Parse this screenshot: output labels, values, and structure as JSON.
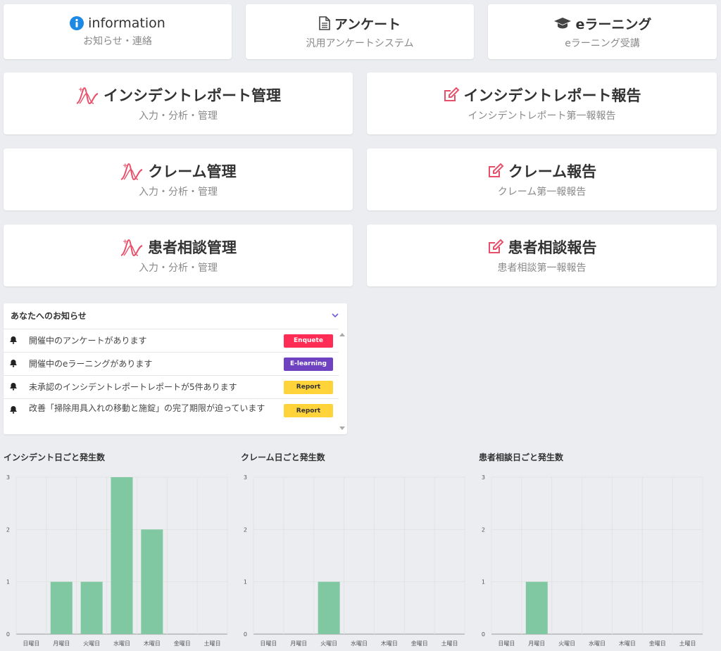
{
  "top_cards": [
    {
      "title": "information",
      "subtitle": "お知らせ・連絡"
    },
    {
      "title": "アンケート",
      "subtitle": "汎用アンケートシステム"
    },
    {
      "title": "eラーニング",
      "subtitle": "eラーニング受講"
    }
  ],
  "main_cards": {
    "incident_mgmt": {
      "title": "インシデントレポート管理",
      "subtitle": "入力・分析・管理"
    },
    "incident_report": {
      "title": "インシデントレポート報告",
      "subtitle": "インシデントレポート第一報報告"
    },
    "claim_mgmt": {
      "title": "クレーム管理",
      "subtitle": "入力・分析・管理"
    },
    "claim_report": {
      "title": "クレーム報告",
      "subtitle": "クレーム第一報報告"
    },
    "patient_mgmt": {
      "title": "患者相談管理",
      "subtitle": "入力・分析・管理"
    },
    "patient_report": {
      "title": "患者相談報告",
      "subtitle": "患者相談第一報報告"
    }
  },
  "notices": {
    "title": "あなたへのお知らせ",
    "items": [
      {
        "text": "開催中のアンケートがあります",
        "badge": "Enquete",
        "badge_color": "#ff2d55",
        "badge_text_color": "#ffffff"
      },
      {
        "text": "開催中のeラーニングがあります",
        "badge": "E-learning",
        "badge_color": "#6f42c1",
        "badge_text_color": "#ffffff"
      },
      {
        "text": "未承認のインシデントレポートレポートが5件あります",
        "badge": "Report",
        "badge_color": "#ffd43b",
        "badge_text_color": "#333333"
      },
      {
        "text": "改善「掃除用具入れの移動と施錠」の完了期限が迫っています",
        "badge": "Report",
        "badge_color": "#ffd43b",
        "badge_text_color": "#333333"
      }
    ]
  },
  "colors": {
    "bar": "#7fc8a2",
    "accent_red": "#e8506a",
    "info_blue": "#1e88e5"
  },
  "chart_data": [
    {
      "type": "bar",
      "title": "インシデント日ごと発生数",
      "categories": [
        "日曜日",
        "月曜日",
        "火曜日",
        "水曜日",
        "木曜日",
        "金曜日",
        "土曜日"
      ],
      "values": [
        0,
        1,
        1,
        3,
        2,
        0,
        0
      ],
      "ylim": [
        0,
        3
      ],
      "yticks": [
        0,
        1,
        2,
        3
      ],
      "grid": true
    },
    {
      "type": "bar",
      "title": "クレーム日ごと発生数",
      "categories": [
        "日曜日",
        "月曜日",
        "火曜日",
        "水曜日",
        "木曜日",
        "金曜日",
        "土曜日"
      ],
      "values": [
        0,
        0,
        1,
        0,
        0,
        0,
        0
      ],
      "ylim": [
        0,
        3
      ],
      "yticks": [
        0,
        1,
        2,
        3
      ],
      "grid": true
    },
    {
      "type": "bar",
      "title": "患者相談日ごと発生数",
      "categories": [
        "日曜日",
        "月曜日",
        "火曜日",
        "水曜日",
        "木曜日",
        "金曜日",
        "土曜日"
      ],
      "values": [
        0,
        1,
        0,
        0,
        0,
        0,
        0
      ],
      "ylim": [
        0,
        3
      ],
      "yticks": [
        0,
        1,
        2,
        3
      ],
      "grid": true
    }
  ]
}
